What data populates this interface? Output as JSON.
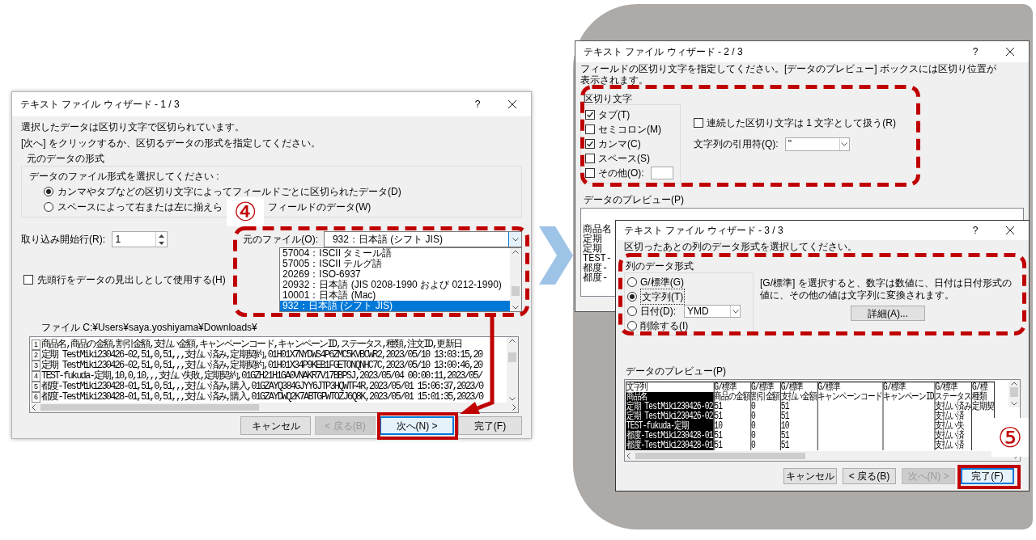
{
  "step1": {
    "title": "テキスト ファイル ウィザード - 1 / 3",
    "help": "?",
    "instructions": [
      "選択したデータは区切り文字で区切られています。",
      "[次へ] をクリックするか、区切るデータの形式を指定してください。"
    ],
    "format_group": {
      "label": "元のデータの形式",
      "prompt": "データのファイル形式を選択してください :",
      "options": [
        {
          "label_parts": [
            "カンマやタブなどの区切り文字によってフィールドごとに区切られたデータ(D)"
          ],
          "selected": true
        },
        {
          "label_parts": [
            "スペースによって右または左に揃えら",
            "フィールドのデータ(W)"
          ],
          "selected": false
        }
      ]
    },
    "badge": "④",
    "start_row": {
      "label": "取り込み開始行(R):",
      "value": "1"
    },
    "origin": {
      "label": "元のファイル(O):",
      "value": "932：日本語 (シフト JIS)",
      "options": [
        {
          "label": "57004：ISCII タミール語",
          "selected": false
        },
        {
          "label": "57005：ISCII テルグ語",
          "selected": false
        },
        {
          "label": "20269：ISO-6937",
          "selected": false
        },
        {
          "label": "20932：日本語 (JIS 0208-1990 および 0212-1990)",
          "selected": false
        },
        {
          "label": "10001：日本語 (Mac)",
          "selected": false
        },
        {
          "label": "932：日本語 (シフト JIS)",
          "selected": true
        }
      ]
    },
    "header_checkbox": {
      "label": "先頭行をデータの見出しとして使用する(H)",
      "checked": false
    },
    "file_path": "ファイル C:¥Users¥saya.yoshiyama¥Downloads¥",
    "preview": [
      {
        "number": "1",
        "text": "商品名,商品の金額,割引金額,支払い金額,キャンペーンコード,キャンペーンID,ステータス,種類,注文ID,更新日"
      },
      {
        "number": "2",
        "text": "定期 TestMiki230426-02,51,0,51,,,支払い済み,定期契約,01H01X7NYDWS4P6ZMC5KVBCWR2,2023/05/10 13:03:15,20"
      },
      {
        "number": "3",
        "text": "定期 TestMiki230426-02,51,0,51,,,支払い済み,定期契約,01H01X34P9KEB1FGETONQNHC7C,2023/05/10 13:00:46,20"
      },
      {
        "number": "4",
        "text": "TEST-fukuda-定期,10,0,10,,,支払い失敗,定期契約,01GZH21H1GA0VNAKR7V17BBPSJ,2023/05/04 00:00:11,2023/05/"
      },
      {
        "number": "5",
        "text": "都度-TestMiki230428-01,51,0,51,,,支払い済み,購入,01GZAYQ384GJYY6JTP3HQWTF4R,2023/05/01 15:06:37,2023/0"
      },
      {
        "number": "6",
        "text": "都度-TestMiki230428-01,51,0,51,,,支払い済み,購入,01GZAYDWQ2K7ABTGPWTOZJ6Q8K,2023/05/01 15:01:35,2023/0"
      }
    ],
    "buttons": [
      {
        "label": "キャンセル",
        "disabled": false,
        "focused": false
      },
      {
        "label": "< 戻る(B)",
        "disabled": true,
        "focused": false
      },
      {
        "label": "次へ(N) >",
        "disabled": false,
        "focused": true
      },
      {
        "label": "完了(F)",
        "disabled": false,
        "focused": false
      }
    ]
  },
  "step2": {
    "title": "テキスト ファイル ウィザード - 2 / 3",
    "help": "?",
    "instruction": "フィールドの区切り文字を指定してください。[データのプレビュー] ボックスには区切り位置が表示されます。",
    "delimiters": {
      "label": "区切り文字",
      "items": [
        {
          "kind": "checkbox",
          "label": "タブ(T)",
          "checked": true
        },
        {
          "kind": "checkbox",
          "label": "セミコロン(M)",
          "checked": false
        },
        {
          "kind": "checkbox",
          "label": "カンマ(C)",
          "checked": true
        },
        {
          "kind": "checkbox",
          "label": "スペース(S)",
          "checked": false
        },
        {
          "kind": "checkbox_with_field",
          "label": "その他(O):",
          "checked": false
        }
      ]
    },
    "consecutive": {
      "label": "連続した区切り文字は 1 文字として扱う(R)",
      "checked": false
    },
    "qualifier": {
      "label": "文字列の引用符(Q):",
      "value": "\""
    },
    "preview_label": "データのプレビュー(P)",
    "preview_rows": [
      "商品名",
      "定期",
      "定期",
      "TEST-",
      "都度-",
      "都度-"
    ]
  },
  "step3": {
    "title": "テキスト ファイル ウィザード - 3 / 3",
    "help": "?",
    "instruction": "区切ったあとの列のデータ形式を選択してください。",
    "column_format": {
      "label": "列のデータ形式",
      "options": [
        {
          "kind": "radio",
          "label": "G/標準(G)",
          "selected": false
        },
        {
          "kind": "radio",
          "label": "文字列(T)",
          "selected": true
        },
        {
          "kind": "radio_with_combo",
          "label": "日付(D):",
          "selected": false,
          "combo_value": "YMD"
        },
        {
          "kind": "radio",
          "label": "削除する(I)",
          "selected": false
        }
      ]
    },
    "description": "[G/標準] を選択すると、数字は数値に、日付は日付形式の値に、その他の値は文字列に変換されます。",
    "details_button": "詳細(A)...",
    "preview_label": "データのプレビュー(P)",
    "preview": {
      "columns": [
        {
          "format": "文字列",
          "selected": true
        },
        {
          "format": "G/標準",
          "selected": false
        },
        {
          "format": "G/標準",
          "selected": false
        },
        {
          "format": "G/標準",
          "selected": false
        },
        {
          "format": "G/標準",
          "selected": false
        },
        {
          "format": "G/標準",
          "selected": false
        },
        {
          "format": "G/標準",
          "selected": false
        },
        {
          "format": "G/標",
          "selected": false
        }
      ],
      "rows": [
        [
          "商品名",
          "商品の金額",
          "割引金額",
          "支払い金額",
          "キャンペーンコード",
          "キャンペーンID",
          "ステータス",
          "種類"
        ],
        [
          "定期 TestMiki230426-02",
          "51",
          "0",
          "51",
          "",
          "",
          "支払い済み",
          "定期契"
        ],
        [
          "定期 TestMiki230426-02",
          "51",
          "0",
          "51",
          "",
          "",
          "支払い済",
          ""
        ],
        [
          "TEST-fukuda-定期",
          "10",
          "0",
          "10",
          "",
          "",
          "支払い失",
          ""
        ],
        [
          "都度-TestMiki230428-01",
          "51",
          "0",
          "51",
          "",
          "",
          "支払い済",
          ""
        ],
        [
          "都度-TestMiki230428-01",
          "51",
          "0",
          "51",
          "",
          "",
          "支払い済",
          ""
        ]
      ]
    },
    "buttons": [
      {
        "label": "キャンセル",
        "disabled": false,
        "focused": false
      },
      {
        "label": "< 戻る(B)",
        "disabled": false,
        "focused": false
      },
      {
        "label": "次へ(N) >",
        "disabled": true,
        "focused": false
      },
      {
        "label": "完了(F)",
        "disabled": false,
        "focused": true
      }
    ],
    "badge": "⑤"
  }
}
